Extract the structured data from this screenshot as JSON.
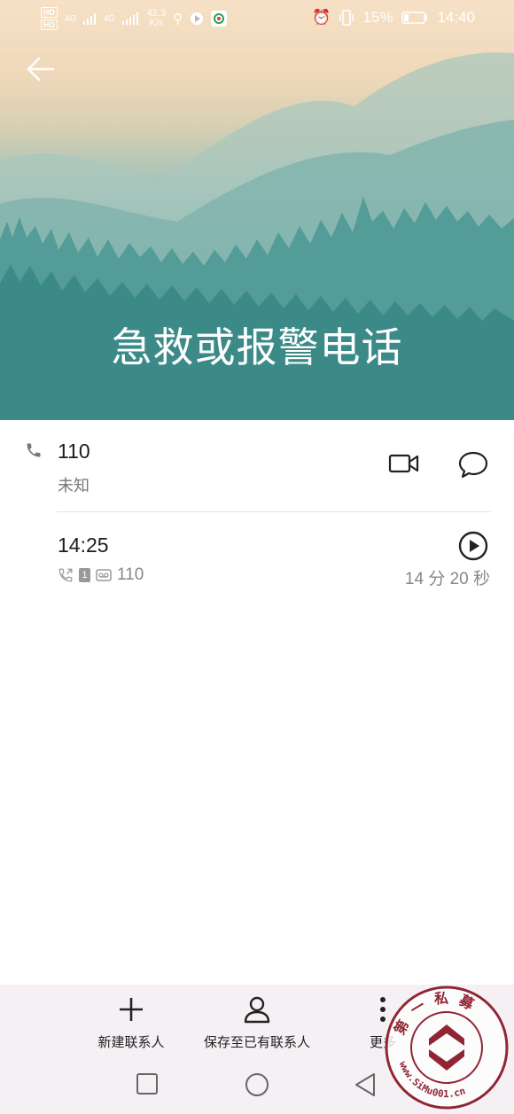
{
  "status_bar": {
    "left": {
      "hd_top": "HD",
      "hd_bottom": "HD",
      "net_type": "4G",
      "net_type2": "4G",
      "speed_value": "42.3",
      "speed_unit": "K/s"
    },
    "right": {
      "battery_pct": "15%",
      "time": "14:40"
    }
  },
  "header": {
    "title": "急救或报警电话"
  },
  "contact": {
    "number": "110",
    "location": "未知"
  },
  "call_log": {
    "time": "14:25",
    "sim": "1",
    "number": "110",
    "duration": "14 分 20 秒"
  },
  "actions": {
    "new_contact": "新建联系人",
    "save_existing": "保存至已有联系人",
    "more": "更多"
  },
  "watermark": {
    "text_top": "第一私募",
    "url": "www.SiMu001.cn"
  },
  "colors": {
    "hero_teal": "#2f7f80",
    "hero_sand": "#f6e1c6",
    "action_bar_bg": "#f4f0f4"
  }
}
